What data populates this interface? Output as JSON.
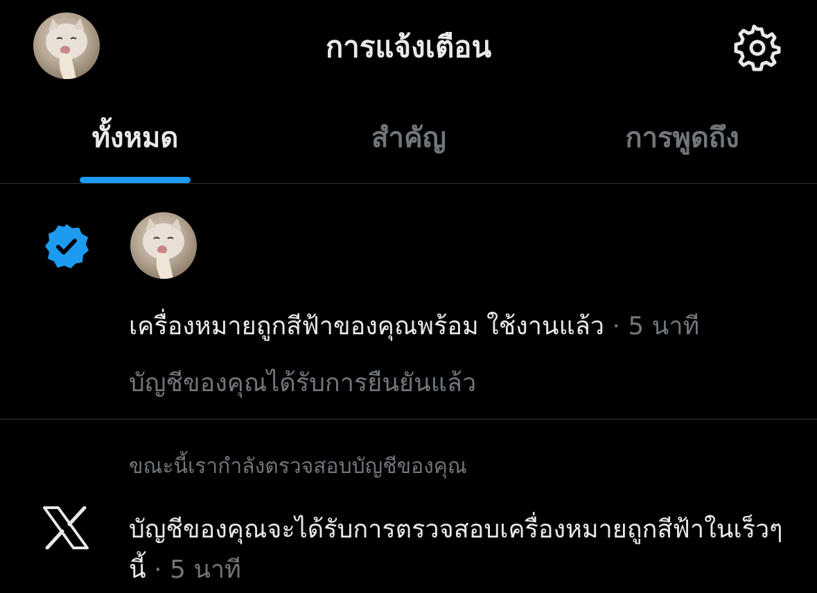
{
  "header": {
    "title": "การแจ้งเตือน",
    "avatar_icon": "cat-avatar",
    "settings_icon": "gear-icon"
  },
  "tabs": [
    {
      "label": "ทั้งหมด",
      "active": true
    },
    {
      "label": "สำคัญ",
      "active": false
    },
    {
      "label": "การพูดถึง",
      "active": false
    }
  ],
  "colors": {
    "background": "#000000",
    "accent": "#1d9bf0",
    "text_primary": "#e7e9ea",
    "text_secondary": "#71767b",
    "divider": "#2f3336"
  },
  "notifications": [
    {
      "icon": "verified-badge-icon",
      "avatar": "cat-avatar",
      "title": "เครื่องหมายถูกสีฟ้าของคุณพร้อม ใช้งานแล้ว",
      "separator": "·",
      "time": "5 นาที",
      "subtitle": "บัญชีของคุณได้รับการยืนยันแล้ว"
    },
    {
      "icon": "x-logo-icon",
      "context": "ขณะนี้เรากำลังตรวจสอบบัญชีของคุณ",
      "body": "บัญชีของคุณจะได้รับการตรวจสอบเครื่องหมายถูกสีฟ้าในเร็วๆ นี้",
      "separator": "·",
      "time": "5 นาที"
    }
  ]
}
